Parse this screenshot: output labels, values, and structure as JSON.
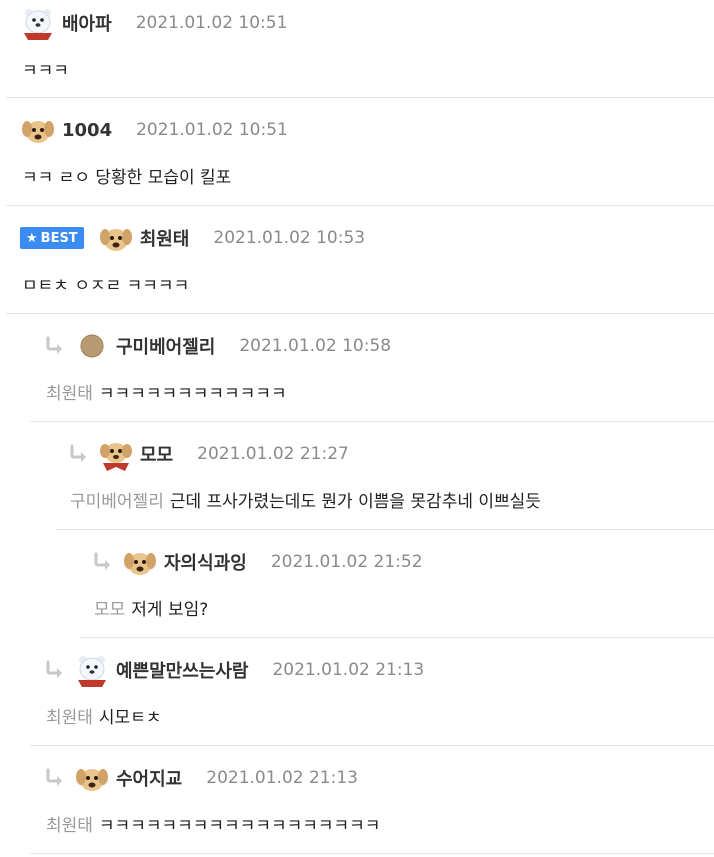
{
  "comments": [
    {
      "avatar": "polar-bear-avatar-icon",
      "nick": "배아파",
      "date": "2021.01.02 10:51",
      "text": "ㅋㅋㅋ"
    },
    {
      "avatar": "puppy-avatar-icon",
      "nick": "1004",
      "date": "2021.01.02 10:51",
      "text": "ㅋㅋ ㄹㅇ 당황한 모습이 킬포"
    },
    {
      "avatar": "puppy-avatar-icon",
      "badge": "BEST",
      "nick": "최원태",
      "date": "2021.01.02 10:53",
      "text": "ㅁㅌㅊ ㅇㅈㄹ ㅋㅋㅋㅋ"
    },
    {
      "avatar": "circle-avatar-icon",
      "nick": "구미베어젤리",
      "date": "2021.01.02 10:58",
      "mention": "최원태",
      "text": "ㅋㅋㅋㅋㅋㅋㅋㅋㅋㅋㅋㅋ"
    },
    {
      "avatar": "puppy-scarf-avatar-icon",
      "nick": "모모",
      "date": "2021.01.02 21:27",
      "mention": "구미베어젤리",
      "text": "근데 프사가렸는데도 뭔가 이쁨을 못감추네 이쁘실듯"
    },
    {
      "avatar": "puppy-avatar-icon",
      "nick": "자의식과잉",
      "date": "2021.01.02 21:52",
      "mention": "모모",
      "text": "저게 보임?"
    },
    {
      "avatar": "polar-bear-avatar-icon",
      "nick": "예쁜말만쓰는사람",
      "date": "2021.01.02 21:13",
      "mention": "최원태",
      "text": "시모ㅌㅊ"
    },
    {
      "avatar": "puppy-avatar-icon",
      "nick": "수어지교",
      "date": "2021.01.02 21:13",
      "mention": "최원태",
      "text": "ㅋㅋㅋㅋㅋㅋㅋㅋㅋㅋㅋㅋㅋㅋㅋㅋㅋㅋ"
    }
  ],
  "colors": {
    "best_badge": "#3a8cf0",
    "date": "#8a8a8a",
    "mention": "#9a9a9a",
    "divider": "#e6e6e6"
  }
}
